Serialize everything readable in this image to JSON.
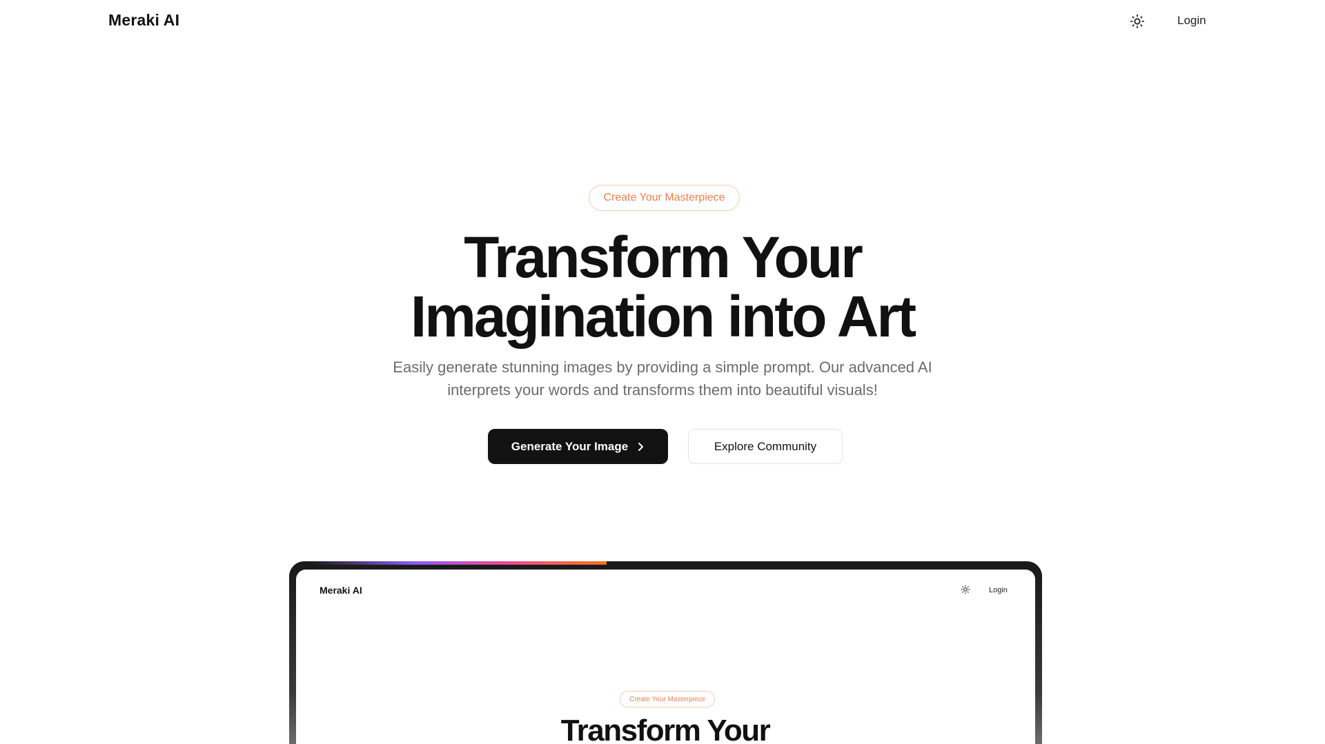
{
  "header": {
    "brand": "Meraki AI",
    "theme_icon": "sun-icon",
    "login_label": "Login"
  },
  "hero": {
    "badge": "Create Your Masterpiece",
    "title_line1": "Transform Your",
    "title_line2": "Imagination into Art",
    "subtitle_line1": "Easily generate stunning images by providing a simple prompt. Our advanced AI",
    "subtitle_line2": "interprets your words and transforms them into beautiful visuals!",
    "primary_button": "Generate Your Image",
    "primary_button_icon": "chevron-right-icon",
    "secondary_button": "Explore Community"
  },
  "preview": {
    "brand": "Meraki AI",
    "theme_icon": "sun-icon",
    "login_label": "Login",
    "badge": "Create Your Masterpiece",
    "title_line1": "Transform Your"
  },
  "colors": {
    "accent_orange": "#e97f4c",
    "badge_border": "#f2cbb6",
    "primary_button_bg": "#121212",
    "glow_purple": "#8b5cf6",
    "glow_pink": "#ec4899",
    "glow_orange": "#f97316"
  }
}
